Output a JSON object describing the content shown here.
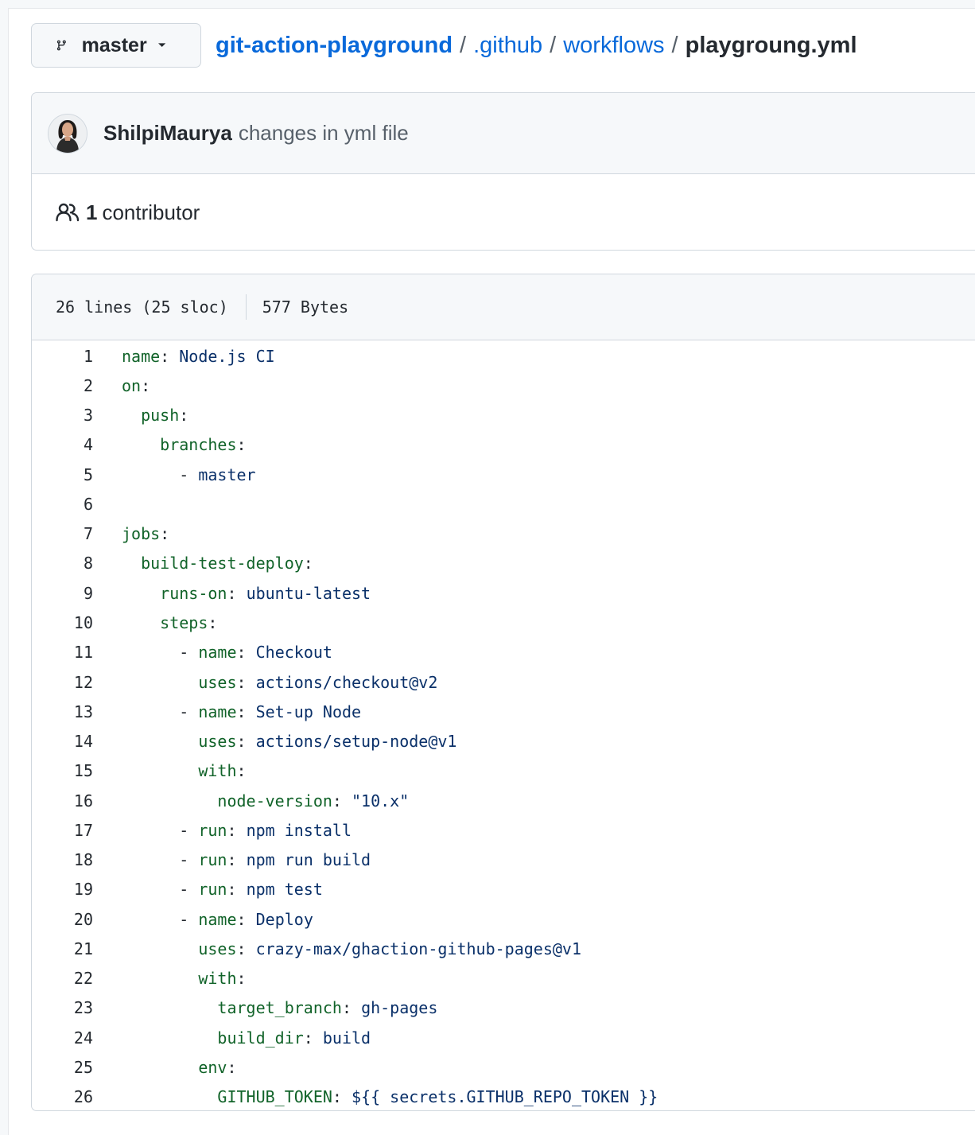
{
  "branch": {
    "name": "master"
  },
  "breadcrumb": {
    "repo": "git-action-playground",
    "dir1": ".github",
    "dir2": "workflows",
    "file": "playgroung.yml",
    "separator": "/"
  },
  "commit": {
    "author": "ShilpiMaurya",
    "message": "changes in yml file"
  },
  "contributors": {
    "count": "1",
    "label": "contributor"
  },
  "file_info": {
    "lines": "26 lines (25 sloc)",
    "size": "577 Bytes"
  },
  "code_lines": [
    {
      "n": "1",
      "indent": "",
      "dash": "",
      "key": "name",
      "val": "Node.js CI"
    },
    {
      "n": "2",
      "indent": "",
      "dash": "",
      "key": "on",
      "val": ""
    },
    {
      "n": "3",
      "indent": "  ",
      "dash": "",
      "key": "push",
      "val": ""
    },
    {
      "n": "4",
      "indent": "    ",
      "dash": "",
      "key": "branches",
      "val": ""
    },
    {
      "n": "5",
      "indent": "      ",
      "dash": "- ",
      "key": "",
      "val": "master"
    },
    {
      "n": "6",
      "indent": "",
      "dash": "",
      "key": "",
      "val": ""
    },
    {
      "n": "7",
      "indent": "",
      "dash": "",
      "key": "jobs",
      "val": ""
    },
    {
      "n": "8",
      "indent": "  ",
      "dash": "",
      "key": "build-test-deploy",
      "val": ""
    },
    {
      "n": "9",
      "indent": "    ",
      "dash": "",
      "key": "runs-on",
      "val": "ubuntu-latest"
    },
    {
      "n": "10",
      "indent": "    ",
      "dash": "",
      "key": "steps",
      "val": ""
    },
    {
      "n": "11",
      "indent": "      ",
      "dash": "- ",
      "key": "name",
      "val": "Checkout"
    },
    {
      "n": "12",
      "indent": "        ",
      "dash": "",
      "key": "uses",
      "val": "actions/checkout@v2"
    },
    {
      "n": "13",
      "indent": "      ",
      "dash": "- ",
      "key": "name",
      "val": "Set-up Node"
    },
    {
      "n": "14",
      "indent": "        ",
      "dash": "",
      "key": "uses",
      "val": "actions/setup-node@v1"
    },
    {
      "n": "15",
      "indent": "        ",
      "dash": "",
      "key": "with",
      "val": ""
    },
    {
      "n": "16",
      "indent": "          ",
      "dash": "",
      "key": "node-version",
      "val": "\"10.x\""
    },
    {
      "n": "17",
      "indent": "      ",
      "dash": "- ",
      "key": "run",
      "val": "npm install"
    },
    {
      "n": "18",
      "indent": "      ",
      "dash": "- ",
      "key": "run",
      "val": "npm run build"
    },
    {
      "n": "19",
      "indent": "      ",
      "dash": "- ",
      "key": "run",
      "val": "npm test"
    },
    {
      "n": "20",
      "indent": "      ",
      "dash": "- ",
      "key": "name",
      "val": "Deploy"
    },
    {
      "n": "21",
      "indent": "        ",
      "dash": "",
      "key": "uses",
      "val": "crazy-max/ghaction-github-pages@v1"
    },
    {
      "n": "22",
      "indent": "        ",
      "dash": "",
      "key": "with",
      "val": ""
    },
    {
      "n": "23",
      "indent": "          ",
      "dash": "",
      "key": "target_branch",
      "val": "gh-pages"
    },
    {
      "n": "24",
      "indent": "          ",
      "dash": "",
      "key": "build_dir",
      "val": "build"
    },
    {
      "n": "25",
      "indent": "        ",
      "dash": "",
      "key": "env",
      "val": ""
    },
    {
      "n": "26",
      "indent": "          ",
      "dash": "",
      "key": "GITHUB_TOKEN",
      "val": "${{ secrets.GITHUB_REPO_TOKEN }}"
    }
  ],
  "icons": {
    "branch": "git-branch-icon",
    "caret": "caret-down-icon",
    "people": "people-icon",
    "avatar": "user-avatar"
  },
  "colors": {
    "link": "#0969da",
    "key": "#116329",
    "value": "#0a3069",
    "border": "#d0d7de",
    "header_bg": "#f6f8fa"
  }
}
